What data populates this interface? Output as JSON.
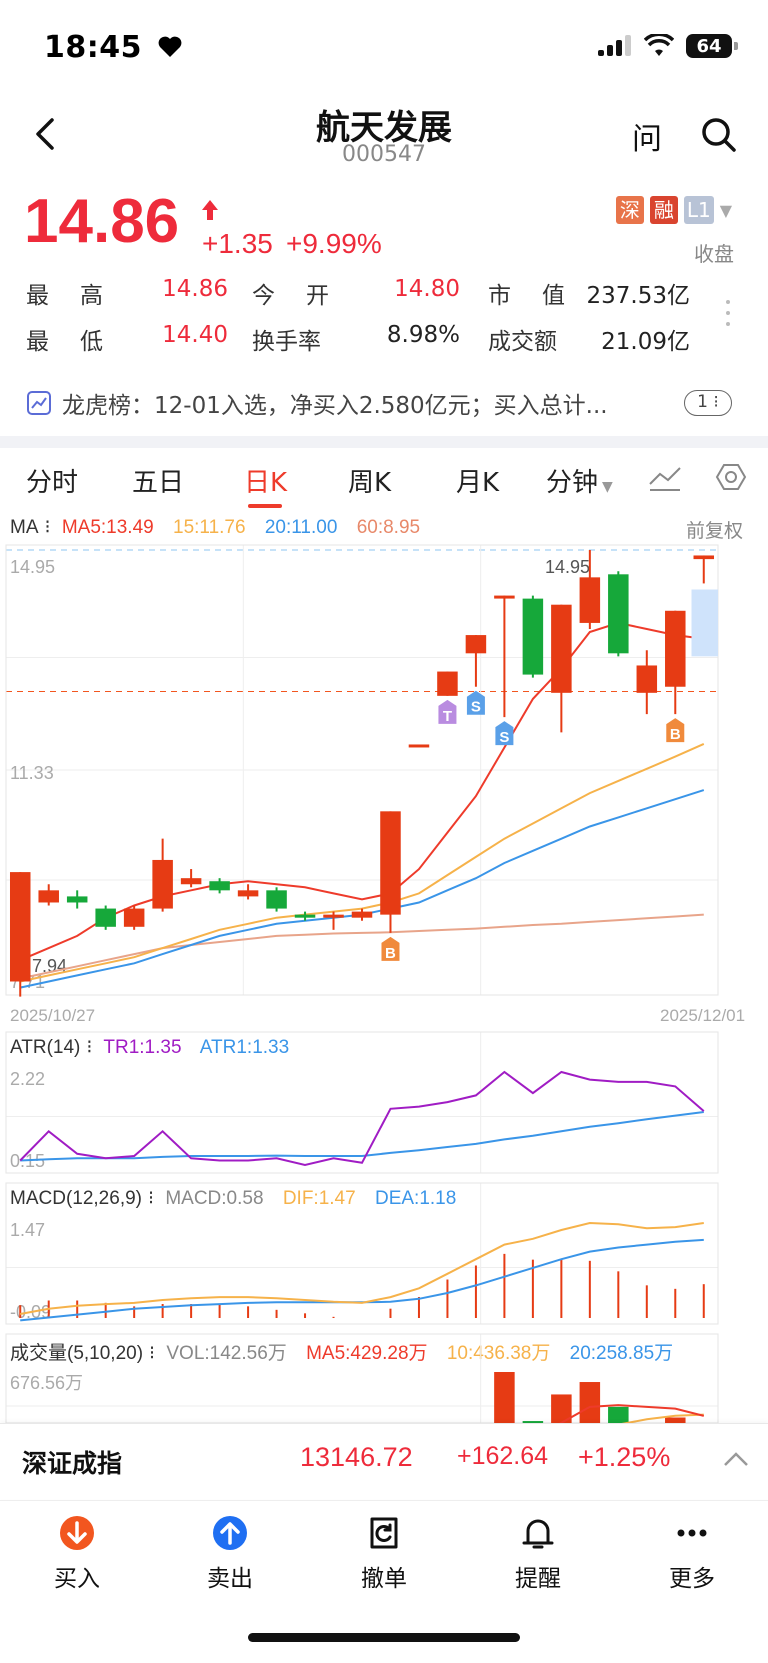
{
  "status_bar": {
    "time": "18:45",
    "battery": "64"
  },
  "header": {
    "title": "航天发展",
    "code": "000547",
    "ask_label": "问"
  },
  "quote": {
    "price": "14.86",
    "change": "+1.35",
    "change_pct": "+9.99%",
    "tags": [
      "深",
      "融",
      "L1"
    ],
    "status": "收盘"
  },
  "stats": {
    "row1": [
      {
        "label": "最　高",
        "value": "14.86"
      },
      {
        "label": "今　开",
        "value": "14.80"
      },
      {
        "label": "市　值",
        "value": "237.53亿"
      }
    ],
    "row2": [
      {
        "label": "最　低",
        "value": "14.40"
      },
      {
        "label": "换手率",
        "value": "8.98%"
      },
      {
        "label": "成交额",
        "value": "21.09亿"
      }
    ]
  },
  "dragon_tiger": {
    "text": "龙虎榜：12-01入选，净买入2.580亿元；买入总计...",
    "badge": "1"
  },
  "tabs": [
    "分时",
    "五日",
    "日K",
    "周K",
    "月K",
    "分钟"
  ],
  "active_tab": "日K",
  "kline_legend": {
    "name": "MA",
    "ma5": "MA5:13.49",
    "ma15": "15:11.76",
    "ma20": "20:11.00",
    "ma60": "60:8.95",
    "adjust": "前复权"
  },
  "kline_axis": {
    "top": "14.95",
    "mid": "11.33",
    "bottom": "7.71",
    "low_mark": "7.94",
    "high_mark": "14.95",
    "date_start": "2025/10/27",
    "date_end": "2025/12/01"
  },
  "atr_legend": {
    "name": "ATR(14)",
    "tr": "TR1:1.35",
    "atr": "ATR1:1.33",
    "top": "2.22",
    "bottom": "0.15"
  },
  "macd_legend": {
    "name": "MACD(12,26,9)",
    "macd": "MACD:0.58",
    "dif": "DIF:1.47",
    "dea": "DEA:1.18",
    "top": "1.47",
    "bottom": "-0.09"
  },
  "vol_legend": {
    "name": "成交量(5,10,20)",
    "vol": "VOL:142.56万",
    "ma5": "MA5:429.28万",
    "ma10": "10:436.38万",
    "ma20": "20:258.85万",
    "top": "676.56万"
  },
  "chart_data": {
    "type": "candlestick",
    "dates": [
      "2025/10/27",
      "",
      "",
      "",
      "",
      "",
      "",
      "",
      "",
      "",
      "",
      "",
      "",
      "",
      "",
      "",
      "",
      "",
      "",
      "",
      "",
      "",
      "",
      "",
      "2025/12/01"
    ],
    "candles": [
      {
        "o": 7.85,
        "c": 9.65,
        "h": 9.65,
        "l": 7.6
      },
      {
        "o": 9.15,
        "c": 9.35,
        "h": 9.45,
        "l": 9.1
      },
      {
        "o": 9.25,
        "c": 9.15,
        "h": 9.35,
        "l": 9.05
      },
      {
        "o": 9.05,
        "c": 8.75,
        "h": 9.1,
        "l": 8.7
      },
      {
        "o": 8.75,
        "c": 9.05,
        "h": 9.1,
        "l": 8.7
      },
      {
        "o": 9.05,
        "c": 9.85,
        "h": 10.2,
        "l": 9.0
      },
      {
        "o": 9.45,
        "c": 9.55,
        "h": 9.7,
        "l": 9.4
      },
      {
        "o": 9.5,
        "c": 9.35,
        "h": 9.55,
        "l": 9.3
      },
      {
        "o": 9.25,
        "c": 9.35,
        "h": 9.45,
        "l": 9.2
      },
      {
        "o": 9.35,
        "c": 9.05,
        "h": 9.4,
        "l": 9.0
      },
      {
        "o": 8.95,
        "c": 8.9,
        "h": 9.0,
        "l": 8.85
      },
      {
        "o": 8.9,
        "c": 8.95,
        "h": 9.0,
        "l": 8.7
      },
      {
        "o": 8.9,
        "c": 9.0,
        "h": 9.05,
        "l": 8.85
      },
      {
        "o": 8.95,
        "c": 10.65,
        "h": 10.65,
        "l": 8.65
      },
      {
        "o": 11.75,
        "c": 11.75,
        "h": 11.75,
        "l": 11.75
      },
      {
        "o": 12.55,
        "c": 12.95,
        "h": 12.95,
        "l": 12.55
      },
      {
        "o": 13.25,
        "c": 13.55,
        "h": 13.55,
        "l": 12.7
      },
      {
        "o": 14.2,
        "c": 14.2,
        "h": 14.2,
        "l": 12.2
      },
      {
        "o": 14.15,
        "c": 12.9,
        "h": 14.2,
        "l": 12.85
      },
      {
        "o": 12.6,
        "c": 14.05,
        "h": 14.05,
        "l": 11.95
      },
      {
        "o": 13.75,
        "c": 14.5,
        "h": 14.95,
        "l": 13.65
      },
      {
        "o": 14.55,
        "c": 13.25,
        "h": 14.6,
        "l": 13.2
      },
      {
        "o": 12.6,
        "c": 13.05,
        "h": 13.3,
        "l": 12.25
      },
      {
        "o": 12.7,
        "c": 13.95,
        "h": 13.95,
        "l": 12.25
      },
      {
        "o": 14.8,
        "c": 14.86,
        "h": 14.86,
        "l": 14.4
      }
    ],
    "ma5": [
      8.2,
      8.4,
      8.6,
      8.9,
      9.1,
      9.25,
      9.35,
      9.45,
      9.5,
      9.45,
      9.4,
      9.3,
      9.2,
      9.3,
      9.7,
      10.3,
      10.9,
      11.7,
      12.5,
      13.0,
      13.6,
      13.75,
      13.65,
      13.55,
      13.49
    ],
    "ma15": [
      7.85,
      7.95,
      8.05,
      8.15,
      8.25,
      8.4,
      8.55,
      8.7,
      8.8,
      8.9,
      8.95,
      9.0,
      9.05,
      9.15,
      9.3,
      9.6,
      9.9,
      10.2,
      10.45,
      10.7,
      10.95,
      11.15,
      11.35,
      11.55,
      11.76
    ],
    "ma20": [
      7.75,
      7.85,
      7.95,
      8.05,
      8.15,
      8.3,
      8.45,
      8.6,
      8.7,
      8.8,
      8.85,
      8.9,
      8.95,
      9.05,
      9.15,
      9.35,
      9.55,
      9.8,
      10.0,
      10.2,
      10.4,
      10.55,
      10.7,
      10.85,
      11.0
    ],
    "ma60": [
      7.9,
      8.0,
      8.1,
      8.2,
      8.3,
      8.4,
      8.45,
      8.5,
      8.55,
      8.6,
      8.62,
      8.64,
      8.65,
      8.66,
      8.68,
      8.7,
      8.72,
      8.75,
      8.78,
      8.8,
      8.83,
      8.86,
      8.89,
      8.92,
      8.95
    ],
    "markers": [
      {
        "index": 13,
        "label": "B",
        "color": "#f08a3c",
        "pos": "below"
      },
      {
        "index": 15,
        "label": "T",
        "color": "#b98ce0",
        "pos": "below"
      },
      {
        "index": 16,
        "label": "S",
        "color": "#5aa0e8",
        "pos": "below"
      },
      {
        "index": 17,
        "label": "S",
        "color": "#5aa0e8",
        "pos": "below"
      },
      {
        "index": 23,
        "label": "B",
        "color": "#f08a3c",
        "pos": "below"
      }
    ],
    "ylim": [
      7.71,
      14.95
    ],
    "atr": {
      "tr": [
        0.25,
        0.9,
        0.4,
        0.3,
        0.35,
        0.9,
        0.3,
        0.25,
        0.25,
        0.3,
        0.15,
        0.3,
        0.2,
        1.4,
        1.45,
        1.55,
        1.7,
        2.22,
        1.75,
        2.22,
        2.05,
        2.0,
        2.0,
        1.9,
        1.35
      ],
      "atr": [
        0.25,
        0.28,
        0.3,
        0.3,
        0.3,
        0.33,
        0.35,
        0.35,
        0.35,
        0.36,
        0.35,
        0.35,
        0.35,
        0.42,
        0.48,
        0.55,
        0.62,
        0.72,
        0.8,
        0.9,
        1.0,
        1.08,
        1.17,
        1.25,
        1.33
      ],
      "ylim": [
        0.15,
        2.22
      ]
    },
    "macd": {
      "dif": [
        -0.09,
        0.0,
        0.05,
        0.08,
        0.1,
        0.15,
        0.18,
        0.2,
        0.2,
        0.18,
        0.15,
        0.12,
        0.1,
        0.2,
        0.35,
        0.6,
        0.85,
        1.1,
        1.2,
        1.35,
        1.47,
        1.45,
        1.38,
        1.4,
        1.47
      ],
      "dea": [
        -0.2,
        -0.15,
        -0.1,
        -0.05,
        0.0,
        0.03,
        0.06,
        0.08,
        0.1,
        0.11,
        0.11,
        0.11,
        0.11,
        0.12,
        0.17,
        0.27,
        0.4,
        0.55,
        0.7,
        0.85,
        0.98,
        1.05,
        1.1,
        1.15,
        1.18
      ],
      "hist": [
        0.22,
        0.3,
        0.3,
        0.26,
        0.2,
        0.24,
        0.24,
        0.24,
        0.2,
        0.14,
        0.08,
        0.02,
        -0.02,
        0.16,
        0.36,
        0.66,
        0.9,
        1.1,
        1.0,
        1.0,
        0.98,
        0.8,
        0.56,
        0.5,
        0.58
      ],
      "ylim": [
        -0.09,
        1.47
      ]
    },
    "volume": {
      "values": [
        120,
        80,
        70,
        60,
        60,
        90,
        50,
        45,
        40,
        45,
        35,
        40,
        40,
        250,
        60,
        200,
        140,
        676.56,
        400,
        550,
        620,
        480,
        380,
        420,
        142.56
      ],
      "up": [
        true,
        true,
        false,
        false,
        true,
        true,
        true,
        false,
        true,
        false,
        false,
        true,
        true,
        true,
        true,
        true,
        true,
        true,
        false,
        true,
        true,
        false,
        true,
        true,
        true
      ],
      "ma5": [
        100,
        100,
        95,
        90,
        80,
        75,
        70,
        60,
        55,
        55,
        45,
        42,
        40,
        80,
        90,
        110,
        140,
        260,
        300,
        390,
        480,
        490,
        480,
        470,
        429.28
      ],
      "ma10": [
        90,
        90,
        90,
        88,
        85,
        80,
        75,
        70,
        65,
        62,
        55,
        50,
        48,
        65,
        70,
        90,
        110,
        180,
        220,
        280,
        330,
        380,
        410,
        430,
        436.38
      ],
      "ylim": [
        0,
        676.56
      ]
    }
  }
}
